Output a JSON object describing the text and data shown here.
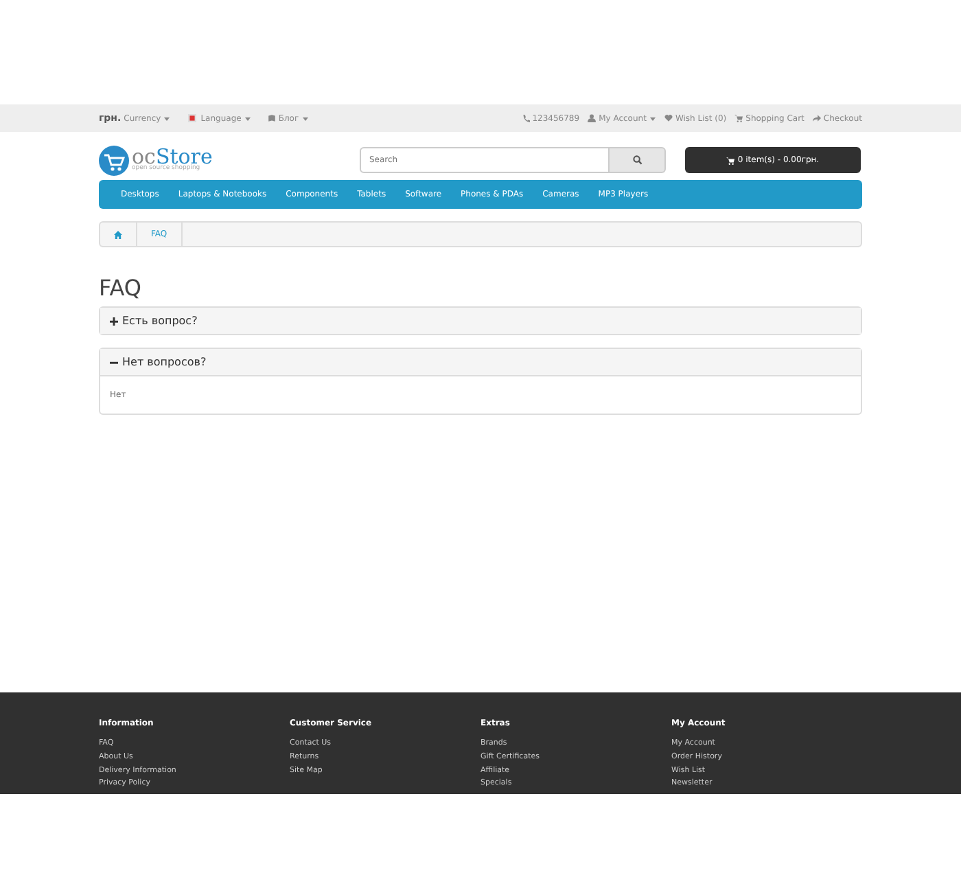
{
  "top_bar": {
    "currency": {
      "symbol": "грн.",
      "label": "Currency"
    },
    "language": {
      "label": "Language"
    },
    "blog": {
      "label": "Блог"
    },
    "phone": "123456789",
    "account": "My Account",
    "wishlist": "Wish List (0)",
    "cart_link": "Shopping Cart",
    "checkout": "Checkout"
  },
  "logo": {
    "prefix": "oc",
    "word": "Store",
    "tagline": "open source shopping"
  },
  "search": {
    "placeholder": "Search"
  },
  "cart_button": "0 item(s) - 0.00грн.",
  "menu": [
    "Desktops",
    "Laptops & Notebooks",
    "Components",
    "Tablets",
    "Software",
    "Phones & PDAs",
    "Cameras",
    "MP3 Players"
  ],
  "breadcrumb": [
    {
      "kind": "home"
    },
    {
      "kind": "link",
      "label": "FAQ"
    }
  ],
  "heading": "FAQ",
  "faq": [
    {
      "question": "Есть вопрос?",
      "expanded": false
    },
    {
      "question": "Нет вопросов?",
      "expanded": true,
      "answer": "Нет"
    }
  ],
  "footer": [
    {
      "title": "Information",
      "links": [
        "FAQ",
        "About Us",
        "Delivery Information",
        "Privacy Policy"
      ]
    },
    {
      "title": "Customer Service",
      "links": [
        "Contact Us",
        "Returns",
        "Site Map"
      ]
    },
    {
      "title": "Extras",
      "links": [
        "Brands",
        "Gift Certificates",
        "Affiliate",
        "Specials"
      ]
    },
    {
      "title": "My Account",
      "links": [
        "My Account",
        "Order History",
        "Wish List",
        "Newsletter"
      ]
    }
  ]
}
